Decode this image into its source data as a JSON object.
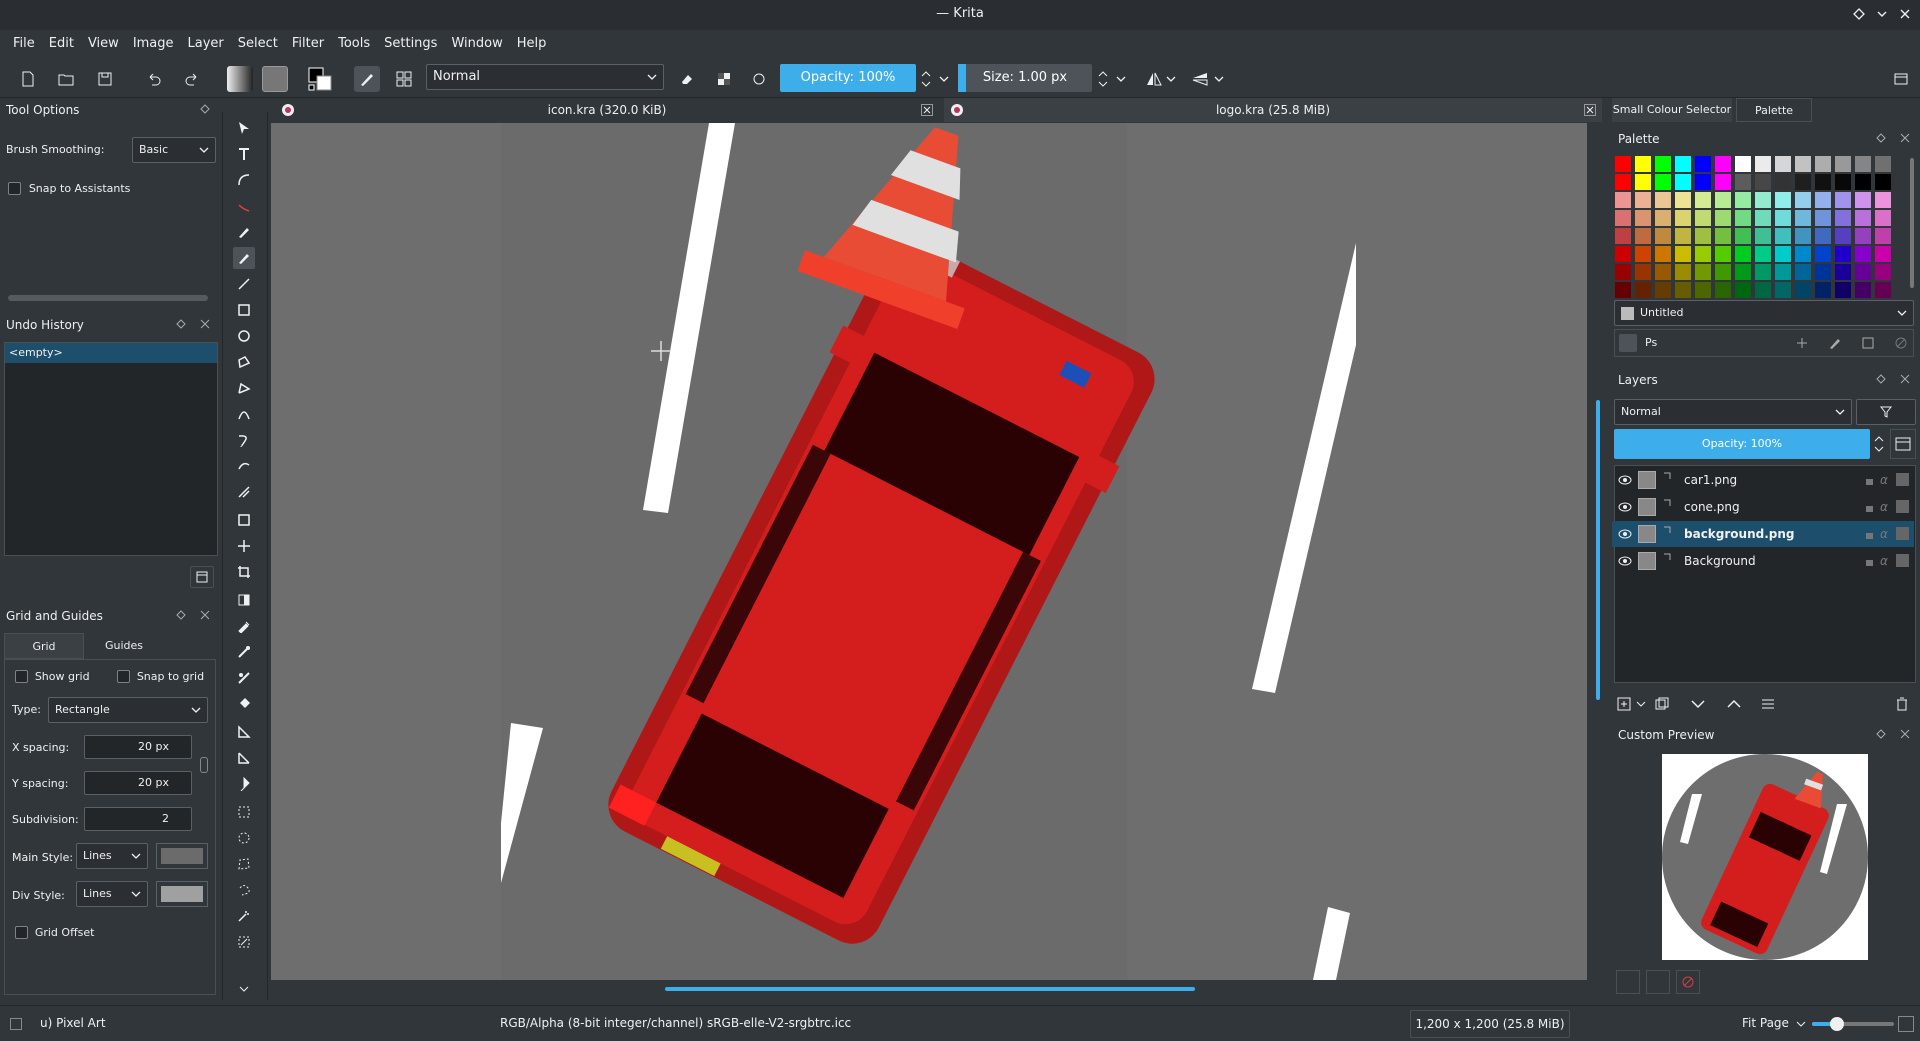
{
  "window": {
    "title": "— Krita"
  },
  "menu": [
    "File",
    "Edit",
    "View",
    "Image",
    "Layer",
    "Select",
    "Filter",
    "Tools",
    "Settings",
    "Window",
    "Help"
  ],
  "toolbar": {
    "blend_mode": "Normal",
    "opacity_label": "Opacity: 100%",
    "size_label": "Size: 1.00 px"
  },
  "tool_options": {
    "title": "Tool Options",
    "brush_smoothing_label": "Brush Smoothing:",
    "brush_smoothing_value": "Basic",
    "snap_label": "Snap to Assistants"
  },
  "undo_history": {
    "title": "Undo History",
    "items": [
      "<empty>"
    ]
  },
  "grid_guides": {
    "title": "Grid and Guides",
    "tabs": [
      "Grid",
      "Guides"
    ],
    "show_grid": "Show grid",
    "snap_grid": "Snap to grid",
    "type_label": "Type:",
    "type_value": "Rectangle",
    "x_label": "X spacing:",
    "x_value": "20 px",
    "y_label": "Y spacing:",
    "y_value": "20 px",
    "sub_label": "Subdivision:",
    "sub_value": "2",
    "main_style_label": "Main Style:",
    "main_style_value": "Lines",
    "div_style_label": "Div Style:",
    "div_style_value": "Lines",
    "offset_label": "Grid Offset",
    "main_color": "#6b6b6b",
    "div_color": "#a0a0a0"
  },
  "documents": [
    {
      "title": "icon.kra (320.0 KiB)"
    },
    {
      "title": "logo.kra (25.8 MiB)"
    }
  ],
  "right_tabs": [
    "Small Colour Selector",
    "Palette"
  ],
  "palette": {
    "title": "Palette",
    "name": "Untitled",
    "preset": "Ps"
  },
  "layers": {
    "title": "Layers",
    "blend": "Normal",
    "opacity": "Opacity:  100%",
    "items": [
      {
        "name": "car1.png",
        "selected": false
      },
      {
        "name": "cone.png",
        "selected": false
      },
      {
        "name": "background.png",
        "selected": true
      },
      {
        "name": "Background",
        "selected": false
      }
    ]
  },
  "preview": {
    "title": "Custom Preview"
  },
  "status": {
    "brush": "u) Pixel Art",
    "color_space": "RGB/Alpha (8-bit integer/channel)  sRGB-elle-V2-srgbtrc.icc",
    "dimensions": "1,200 x 1,200 (25.8 MiB)",
    "zoom": "Fit Page"
  },
  "colors": {
    "accent": "#3daee9",
    "selection": "#1d4e6b",
    "car": "#d41e1e",
    "road": "#6b6b6b"
  }
}
